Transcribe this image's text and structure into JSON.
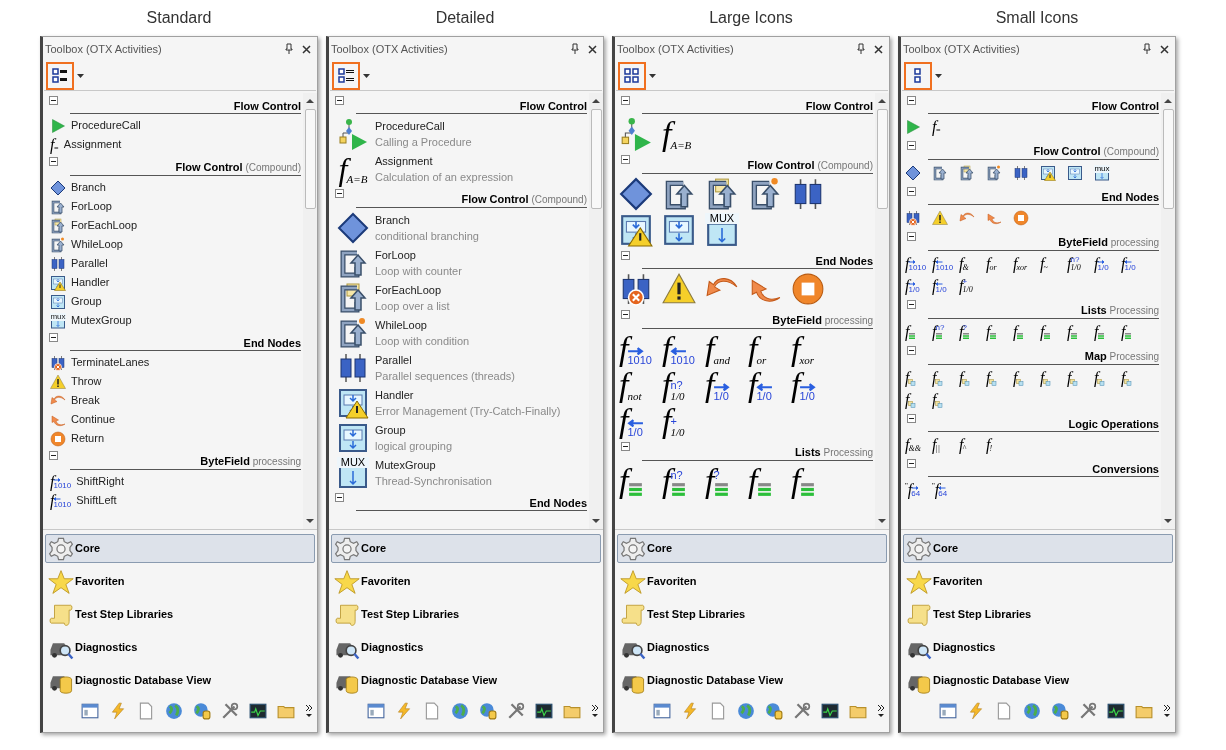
{
  "panels": [
    {
      "caption": "Standard",
      "title": "Toolbox (OTX Activities)",
      "kind": "standard",
      "view_button": {
        "highlighted": true
      },
      "groups": [
        {
          "title": "Flow Control",
          "expanded": true,
          "items": [
            {
              "name": "ProcedureCall",
              "icon": {
                "kind": "play"
              }
            },
            {
              "name": "Assignment",
              "icon": {
                "kind": "func",
                "glyph": "f",
                "sub": "="
              }
            }
          ]
        },
        {
          "title": "Flow Control",
          "note": "(Compound)",
          "expanded": true,
          "items": [
            {
              "name": "Branch",
              "icon": {
                "kind": "diamond"
              }
            },
            {
              "name": "ForLoop",
              "icon": {
                "kind": "loop"
              }
            },
            {
              "name": "ForEachLoop",
              "icon": {
                "kind": "foreach"
              }
            },
            {
              "name": "WhileLoop",
              "icon": {
                "kind": "while"
              }
            },
            {
              "name": "Parallel",
              "icon": {
                "kind": "parallel"
              }
            },
            {
              "name": "Handler",
              "icon": {
                "kind": "handler"
              }
            },
            {
              "name": "Group",
              "icon": {
                "kind": "group"
              }
            },
            {
              "name": "MutexGroup",
              "icon": {
                "kind": "mux",
                "text": "mux"
              }
            }
          ]
        },
        {
          "title": "End Nodes",
          "expanded": true,
          "items": [
            {
              "name": "TerminateLanes",
              "icon": {
                "kind": "terminate"
              }
            },
            {
              "name": "Throw",
              "icon": {
                "kind": "warning"
              }
            },
            {
              "name": "Break",
              "icon": {
                "kind": "break"
              }
            },
            {
              "name": "Continue",
              "icon": {
                "kind": "continue"
              }
            },
            {
              "name": "Return",
              "icon": {
                "kind": "return"
              }
            }
          ]
        },
        {
          "title": "ByteField",
          "note": "processing",
          "expanded": true,
          "items": [
            {
              "name": "ShiftRight",
              "icon": {
                "kind": "func",
                "glyph": "f",
                "sub": "1010",
                "arrow": {
                  "kind": "right"
                }
              }
            },
            {
              "name": "ShiftLeft",
              "icon": {
                "kind": "func",
                "glyph": "f",
                "sub": "1010",
                "arrow": {
                  "kind": "left"
                }
              }
            }
          ]
        }
      ],
      "nav": [
        {
          "label": "Core",
          "selected": true
        },
        {
          "label": "Favoriten",
          "selected": false
        },
        {
          "label": "Test Step Libraries",
          "selected": false
        },
        {
          "label": "Diagnostics",
          "selected": false
        },
        {
          "label": "Diagnostic Database View",
          "selected": false
        }
      ]
    },
    {
      "caption": "Detailed",
      "title": "Toolbox (OTX Activities)",
      "kind": "detailed",
      "view_button": {
        "highlighted": true
      },
      "groups": [
        {
          "title": "Flow Control",
          "expanded": true,
          "items": [
            {
              "name": "ProcedureCall",
              "description": "Calling a Procedure",
              "icon": {
                "kind": "proc"
              }
            },
            {
              "name": "Assignment",
              "description": "Calculation of an expression",
              "icon": {
                "kind": "func",
                "glyph": "f",
                "sub": "A=B"
              }
            }
          ]
        },
        {
          "title": "Flow Control",
          "note": "(Compound)",
          "expanded": true,
          "items": [
            {
              "name": "Branch",
              "description": "conditional branching",
              "icon": {
                "kind": "diamond"
              }
            },
            {
              "name": "ForLoop",
              "description": "Loop with counter",
              "icon": {
                "kind": "loop"
              }
            },
            {
              "name": "ForEachLoop",
              "description": "Loop over a list",
              "icon": {
                "kind": "foreach"
              }
            },
            {
              "name": "WhileLoop",
              "description": "Loop with condition",
              "icon": {
                "kind": "while"
              }
            },
            {
              "name": "Parallel",
              "description": "Parallel sequences (threads)",
              "icon": {
                "kind": "parallel"
              }
            },
            {
              "name": "Handler",
              "description": "Error Management (Try-Catch-Finally)",
              "icon": {
                "kind": "handler"
              }
            },
            {
              "name": "Group",
              "description": "logical grouping",
              "icon": {
                "kind": "group"
              }
            },
            {
              "name": "MutexGroup",
              "description": "Thread-Synchronisation",
              "icon": {
                "kind": "mux",
                "text": "MUX"
              }
            }
          ]
        },
        {
          "title": "End Nodes",
          "expanded": true
        }
      ],
      "nav": [
        {
          "label": "Core",
          "selected": true
        },
        {
          "label": "Favoriten",
          "selected": false
        },
        {
          "label": "Test Step Libraries",
          "selected": false
        },
        {
          "label": "Diagnostics",
          "selected": false
        },
        {
          "label": "Diagnostic Database View",
          "selected": false
        }
      ]
    },
    {
      "caption": "Large Icons",
      "title": "Toolbox (OTX Activities)",
      "kind": "large",
      "view_button": {
        "highlighted": true
      },
      "groups": [
        {
          "title": "Flow Control",
          "expanded": true,
          "items": [
            {
              "kind": "proc"
            },
            {
              "kind": "func",
              "glyph": "f",
              "sub": "A=B"
            }
          ]
        },
        {
          "title": "Flow Control",
          "note": "(Compound)",
          "expanded": true,
          "items": [
            {
              "kind": "diamond"
            },
            {
              "kind": "loop"
            },
            {
              "kind": "foreach"
            },
            {
              "kind": "while"
            },
            {
              "kind": "parallel"
            },
            {
              "kind": "handler"
            },
            {
              "kind": "group"
            },
            {
              "kind": "mux",
              "text": "MUX"
            }
          ]
        },
        {
          "title": "End Nodes",
          "expanded": true,
          "items": [
            {
              "kind": "terminate"
            },
            {
              "kind": "warning"
            },
            {
              "kind": "break"
            },
            {
              "kind": "continue"
            },
            {
              "kind": "return"
            }
          ]
        },
        {
          "title": "ByteField",
          "note": "processing",
          "expanded": true,
          "items": [
            {
              "kind": "func",
              "glyph": "f",
              "sub": "1010",
              "arrow": {
                "kind": "right"
              }
            },
            {
              "kind": "func",
              "glyph": "f",
              "sub": "1010",
              "arrow": {
                "kind": "left"
              }
            },
            {
              "kind": "func",
              "glyph": "f",
              "sub": "and"
            },
            {
              "kind": "func",
              "glyph": "f",
              "sub": "or"
            },
            {
              "kind": "func",
              "glyph": "f",
              "sub": "xor"
            },
            {
              "kind": "func",
              "glyph": "f",
              "sub": "not"
            },
            {
              "kind": "func",
              "glyph": "f",
              "sub": "1/0",
              "sup": "n?"
            },
            {
              "kind": "func",
              "glyph": "f",
              "sub": "1/0",
              "arrow": {
                "kind": "right"
              }
            },
            {
              "kind": "func",
              "glyph": "f",
              "sub": "1/0",
              "arrow": {
                "kind": "left"
              }
            },
            {
              "kind": "func",
              "glyph": "f",
              "sub": "1/0",
              "arrow": {
                "kind": "right"
              }
            },
            {
              "kind": "func",
              "glyph": "f",
              "sub": "1/0",
              "arrow": {
                "kind": "left"
              }
            },
            {
              "kind": "func",
              "glyph": "f",
              "sub": "1/0",
              "sup": "+"
            }
          ]
        },
        {
          "title": "Lists",
          "note": "Processing",
          "expanded": true,
          "items": [
            {
              "kind": "list",
              "glyph": "f"
            },
            {
              "kind": "list",
              "glyph": "f",
              "sup": "n?"
            },
            {
              "kind": "list",
              "glyph": "f",
              "sup": "?"
            },
            {
              "kind": "list",
              "glyph": "f"
            },
            {
              "kind": "list",
              "glyph": "f"
            }
          ]
        }
      ],
      "nav": [
        {
          "label": "Core",
          "selected": true
        },
        {
          "label": "Favoriten",
          "selected": false
        },
        {
          "label": "Test Step Libraries",
          "selected": false
        },
        {
          "label": "Diagnostics",
          "selected": false
        },
        {
          "label": "Diagnostic Database View",
          "selected": false
        }
      ]
    },
    {
      "caption": "Small Icons",
      "title": "Toolbox (OTX Activities)",
      "kind": "small",
      "view_button": {
        "highlighted": true
      },
      "groups": [
        {
          "title": "Flow Control",
          "expanded": true,
          "items": [
            {
              "kind": "play"
            },
            {
              "kind": "func",
              "glyph": "f",
              "sub": "="
            }
          ]
        },
        {
          "title": "Flow Control",
          "note": "(Compound)",
          "expanded": true,
          "items": [
            {
              "kind": "diamond"
            },
            {
              "kind": "loop"
            },
            {
              "kind": "foreach"
            },
            {
              "kind": "while"
            },
            {
              "kind": "parallel"
            },
            {
              "kind": "handler"
            },
            {
              "kind": "group"
            },
            {
              "kind": "mux",
              "text": "mux"
            }
          ]
        },
        {
          "title": "End Nodes",
          "expanded": true,
          "items": [
            {
              "kind": "terminate"
            },
            {
              "kind": "warning"
            },
            {
              "kind": "break"
            },
            {
              "kind": "continue"
            },
            {
              "kind": "return"
            }
          ]
        },
        {
          "title": "ByteField",
          "note": "processing",
          "expanded": true,
          "items": [
            {
              "kind": "func",
              "glyph": "f",
              "sub": "1010",
              "arrow": {
                "kind": "right"
              }
            },
            {
              "kind": "func",
              "glyph": "f",
              "sub": "1010",
              "arrow": {
                "kind": "left"
              }
            },
            {
              "kind": "func",
              "glyph": "f",
              "sub": "&"
            },
            {
              "kind": "func",
              "glyph": "f",
              "sub": "or"
            },
            {
              "kind": "func",
              "glyph": "f",
              "sub": "xor"
            },
            {
              "kind": "func",
              "glyph": "f",
              "sub": "~"
            },
            {
              "kind": "func",
              "glyph": "f",
              "sub": "1/0",
              "sup": "n?"
            },
            {
              "kind": "func",
              "glyph": "f",
              "sub": "1/0",
              "arrow": {
                "kind": "right"
              }
            },
            {
              "kind": "func",
              "glyph": "f",
              "sub": "1/0",
              "arrow": {
                "kind": "left"
              }
            },
            {
              "kind": "func",
              "glyph": "f",
              "sub": "1/0",
              "arrow": {
                "kind": "right"
              }
            },
            {
              "kind": "func",
              "glyph": "f",
              "sub": "1/0",
              "arrow": {
                "kind": "left"
              }
            },
            {
              "kind": "func",
              "glyph": "f",
              "sub": "1/0",
              "sup": "+"
            }
          ]
        },
        {
          "title": "Lists",
          "note": "Processing",
          "expanded": true,
          "items": [
            {
              "kind": "list",
              "glyph": "f"
            },
            {
              "kind": "list",
              "glyph": "f",
              "sup": "n?"
            },
            {
              "kind": "list",
              "glyph": "f",
              "sup": "?"
            },
            {
              "kind": "list",
              "glyph": "f"
            },
            {
              "kind": "list",
              "glyph": "f"
            },
            {
              "kind": "list",
              "glyph": "f"
            },
            {
              "kind": "list",
              "glyph": "f"
            },
            {
              "kind": "list",
              "glyph": "f"
            },
            {
              "kind": "list",
              "glyph": "f"
            }
          ]
        },
        {
          "title": "Map",
          "note": "Processing",
          "expanded": true,
          "items": [
            {
              "kind": "map",
              "glyph": "f"
            },
            {
              "kind": "map",
              "glyph": "f"
            },
            {
              "kind": "map",
              "glyph": "f"
            },
            {
              "kind": "map",
              "glyph": "f"
            },
            {
              "kind": "map",
              "glyph": "f"
            },
            {
              "kind": "map",
              "glyph": "f"
            },
            {
              "kind": "map",
              "glyph": "f"
            },
            {
              "kind": "map",
              "glyph": "f"
            },
            {
              "kind": "map",
              "glyph": "f"
            },
            {
              "kind": "map",
              "glyph": "f"
            },
            {
              "kind": "map",
              "glyph": "f"
            }
          ]
        },
        {
          "title": "Logic Operations",
          "expanded": true,
          "items": [
            {
              "kind": "func",
              "glyph": "f",
              "sub": "&&"
            },
            {
              "kind": "func",
              "glyph": "f",
              "sub": "||"
            },
            {
              "kind": "func",
              "glyph": "f",
              "sub": "^"
            },
            {
              "kind": "func",
              "glyph": "f",
              "sub": "!"
            }
          ]
        },
        {
          "title": "Conversions",
          "expanded": true,
          "items": [
            {
              "kind": "func",
              "pre": "\"",
              "glyph": "f",
              "sub": "64",
              "arrow": {
                "kind": "right"
              }
            },
            {
              "kind": "func",
              "pre": "\"",
              "glyph": "f",
              "sub": "64",
              "arrow": {
                "kind": "left"
              }
            }
          ]
        }
      ],
      "nav": [
        {
          "label": "Core",
          "selected": true
        },
        {
          "label": "Favoriten",
          "selected": false
        },
        {
          "label": "Test Step Libraries",
          "selected": false
        },
        {
          "label": "Diagnostics",
          "selected": false
        },
        {
          "label": "Diagnostic Database View",
          "selected": false
        }
      ]
    }
  ]
}
